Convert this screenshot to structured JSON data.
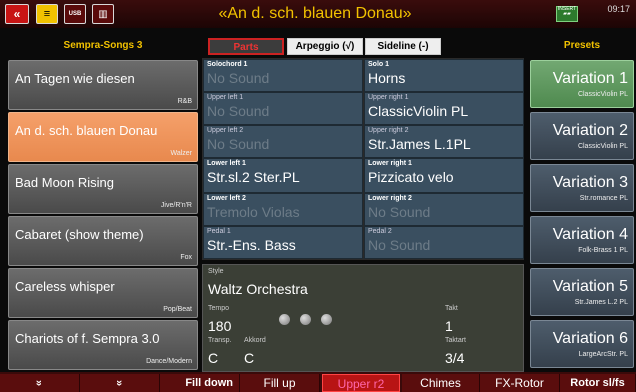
{
  "header": {
    "title": "«An d. sch. blauen Donau»",
    "clock": "09:17",
    "insert_label": "INSERT",
    "usb_label": "USB"
  },
  "columns": {
    "left": "Sempra-Songs 3",
    "right": "Presets"
  },
  "tabs": {
    "parts": "Parts",
    "arpeggio": "Arpeggio (√)",
    "sideline": "Sideline (-)"
  },
  "songs": [
    {
      "name": "An Tagen wie diesen",
      "genre": "R&B"
    },
    {
      "name": "An d. sch. blauen Donau",
      "genre": "Walzer"
    },
    {
      "name": "Bad Moon Rising",
      "genre": "Jive/R'n'R"
    },
    {
      "name": "Cabaret (show theme)",
      "genre": "Fox"
    },
    {
      "name": "Careless whisper",
      "genre": "Pop/Beat"
    },
    {
      "name": "Chariots of f. Sempra 3.0",
      "genre": "Dance/Modern"
    }
  ],
  "parts": {
    "solochord1": {
      "label": "Solochord 1",
      "value": "No Sound"
    },
    "solo1": {
      "label": "Solo 1",
      "value": "Horns"
    },
    "upper_left1": {
      "label": "Upper left 1",
      "value": "No Sound"
    },
    "upper_right1": {
      "label": "Upper right 1",
      "value": "ClassicViolin PL"
    },
    "upper_left2": {
      "label": "Upper left 2",
      "value": "No Sound"
    },
    "upper_right2": {
      "label": "Upper right 2",
      "value": "Str.James L.1PL"
    },
    "lower_left1": {
      "label": "Lower left 1",
      "value": "Str.sl.2 Ster.PL"
    },
    "lower_right1": {
      "label": "Lower right 1",
      "value": "Pizzicato velo"
    },
    "lower_left2": {
      "label": "Lower left 2",
      "value": "Tremolo Violas"
    },
    "lower_right2": {
      "label": "Lower right 2",
      "value": "No Sound"
    },
    "pedal1": {
      "label": "Pedal 1",
      "value": "Str.-Ens. Bass"
    },
    "pedal2": {
      "label": "Pedal 2",
      "value": "No Sound"
    }
  },
  "style": {
    "label": "Style",
    "name": "Waltz Orchestra",
    "tempo_label": "Tempo",
    "tempo": "180",
    "takt_label": "Takt",
    "takt": "1",
    "transp_label": "Transp.",
    "transp": "C",
    "akkord_label": "Akkord",
    "akkord": "C",
    "taktart_label": "Taktart",
    "taktart": "3/4"
  },
  "variations": [
    {
      "name": "Variation 1",
      "sub": "ClassicViolin PL"
    },
    {
      "name": "Variation 2",
      "sub": "ClassicViolin PL"
    },
    {
      "name": "Variation 3",
      "sub": "Str.romance PL"
    },
    {
      "name": "Variation 4",
      "sub": "Folk-Brass 1 PL"
    },
    {
      "name": "Variation 5",
      "sub": "Str.James L.2 PL"
    },
    {
      "name": "Variation 6",
      "sub": "LargeArcStr. PL"
    }
  ],
  "bottom": {
    "up": "«",
    "down": "»",
    "fill_down": "Fill down",
    "fill_up": "Fill up",
    "upper_r2": "Upper r2",
    "chimes": "Chimes",
    "fx_rotor": "FX-Rotor",
    "rotor": "Rotor sl/fs"
  }
}
